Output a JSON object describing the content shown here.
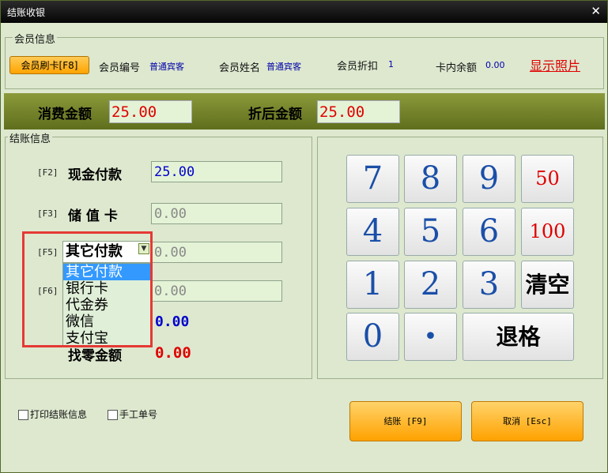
{
  "window": {
    "title": "结账收银",
    "close_glyph": "✕"
  },
  "member": {
    "group_label": "会员信息",
    "swipe_button": "会员刷卡[F8]",
    "number_label": "会员编号",
    "number_value": "普通宾客",
    "name_label": "会员姓名",
    "name_value": "普通宾客",
    "discount_label": "会员折扣",
    "discount_value": "1",
    "balance_label": "卡内余额",
    "balance_value": "0.00",
    "photo_link": "显示照片"
  },
  "amounts": {
    "consume_label": "消费金额",
    "consume_value": "25.00",
    "after_discount_label": "折后金额",
    "after_discount_value": "25.00"
  },
  "checkout": {
    "group_label": "结账信息",
    "rows": [
      {
        "fkey": "[F2]",
        "label": "现金付款",
        "value": "25.00"
      },
      {
        "fkey": "[F3]",
        "label": "储 值 卡",
        "value": "0.00"
      },
      {
        "fkey": "[F5]",
        "select_value": "其它付款",
        "value": "0.00"
      },
      {
        "fkey": "[F6]",
        "value": "0.00"
      }
    ],
    "dropdown_options": [
      "其它付款",
      "银行卡",
      "代金券",
      "微信",
      "支付宝"
    ],
    "paid_value": "0.00",
    "change_label": "找零金额",
    "change_value": "0.00"
  },
  "keypad": {
    "keys": [
      "7",
      "8",
      "9",
      "50",
      "4",
      "5",
      "6",
      "100",
      "1",
      "2",
      "3",
      "清空",
      "0",
      "•",
      "退格"
    ]
  },
  "bottom": {
    "print_checkbox": "打印结账信息",
    "manual_checkbox": "手工单号",
    "checkout_button": "结账 [F9]",
    "cancel_button": "取消 [Esc]"
  },
  "colors": {
    "accent": "#ffa300",
    "band": "#6f7d25",
    "background": "#dde8cf",
    "highlight": "#3399ff"
  }
}
